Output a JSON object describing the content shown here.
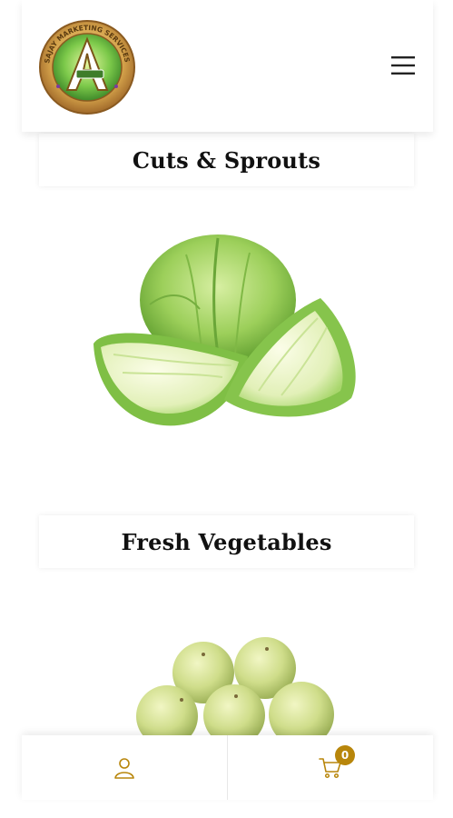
{
  "header": {
    "logo": {
      "ring_text": "SAJAY MARKETING SERVICES PRIVATE LIMITED",
      "emblem_letter": "A"
    },
    "menu_icon": "hamburger-menu-icon"
  },
  "categories": [
    {
      "title": "Cuts & Sprouts",
      "image": "cabbage-image"
    },
    {
      "title": "Fresh Vegetables",
      "image": "amla-gooseberry-image"
    }
  ],
  "bottom_bar": {
    "account_icon": "user-icon",
    "cart_icon": "cart-icon",
    "cart_count": "0"
  },
  "colors": {
    "accent": "#b8860b",
    "title_text": "#111111",
    "background": "#ffffff",
    "cabbage_green": "#8cc63f",
    "amla_green": "#c9d98a"
  }
}
